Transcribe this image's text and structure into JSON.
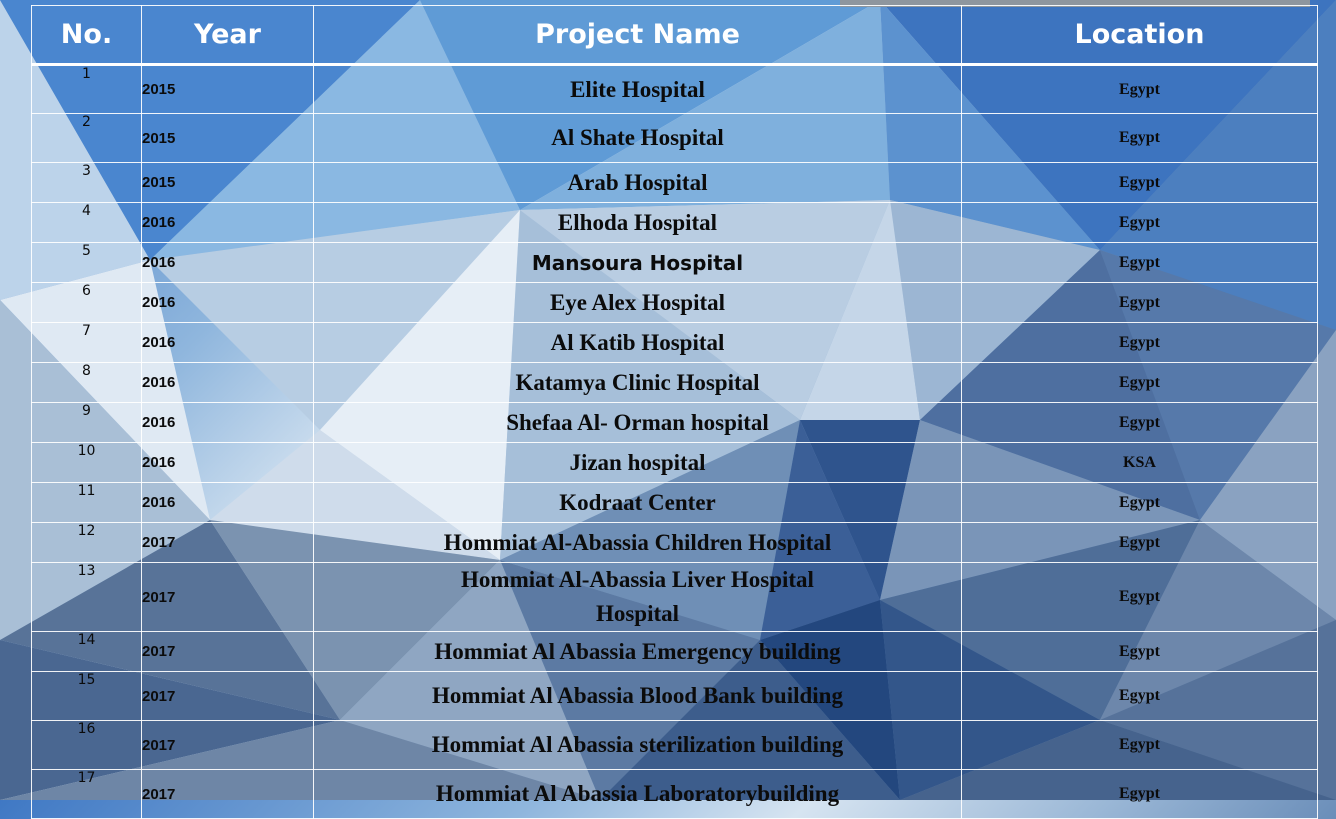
{
  "header": {
    "no": "No.",
    "year": "Year",
    "project_name": "Project Name",
    "location": "Location"
  },
  "rows": [
    {
      "no": "1",
      "year": "2015",
      "name": "Elite Hospital",
      "location": "Egypt"
    },
    {
      "no": "2",
      "year": "2015",
      "name": "Al Shate Hospital",
      "location": "Egypt"
    },
    {
      "no": "3",
      "year": "2015",
      "name": "Arab Hospital",
      "location": "Egypt"
    },
    {
      "no": "4",
      "year": "2016",
      "name": "Elhoda Hospital",
      "location": "Egypt"
    },
    {
      "no": "5",
      "year": "2016",
      "name": "Mansoura Hospital",
      "location": "Egypt"
    },
    {
      "no": "6",
      "year": "2016",
      "name": "Eye Alex Hospital",
      "location": "Egypt"
    },
    {
      "no": "7",
      "year": "2016",
      "name": "Al Katib Hospital",
      "location": "Egypt"
    },
    {
      "no": "8",
      "year": "2016",
      "name": "Katamya Clinic Hospital",
      "location": "Egypt"
    },
    {
      "no": "9",
      "year": "2016",
      "name": "Shefaa Al- Orman hospital",
      "location": "Egypt"
    },
    {
      "no": "10",
      "year": "2016",
      "name": "Jizan hospital",
      "location": "KSA"
    },
    {
      "no": "11",
      "year": "2016",
      "name": "Kodraat Center",
      "location": "Egypt"
    },
    {
      "no": "12",
      "year": "2017",
      "name": "Hommiat Al-Abassia Children Hospital",
      "location": "Egypt"
    },
    {
      "no": "13",
      "year": "2017",
      "name": "Hommiat Al-Abassia Liver Hospital",
      "name_line2": "Hospital",
      "location": "Egypt"
    },
    {
      "no": "14",
      "year": "2017",
      "name": "Hommiat Al Abassia Emergency building",
      "location": "Egypt"
    },
    {
      "no": "15",
      "year": "2017",
      "name": "Hommiat Al Abassia Blood Bank building",
      "location": "Egypt"
    },
    {
      "no": "16",
      "year": "2017",
      "name": "Hommiat Al Abassia sterilization building",
      "location": "Egypt"
    },
    {
      "no": "17",
      "year": "2017",
      "name": "Hommiat Al Abassia Laboratorybuilding",
      "location": "Egypt"
    }
  ]
}
